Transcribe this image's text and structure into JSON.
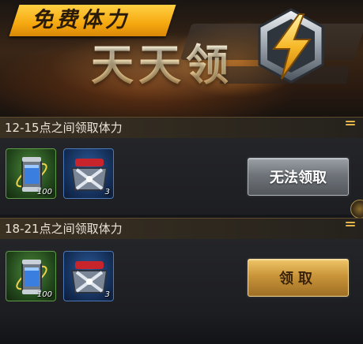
{
  "banner": {
    "tag": "免费体力",
    "title": "天天领",
    "emblem_icon": "lightning-bolt-emblem-icon"
  },
  "slots": [
    {
      "title": "12-15点之间领取体力",
      "items": [
        {
          "icon": "energy-canister-icon",
          "rarity": "green",
          "count": "100"
        },
        {
          "icon": "blue-car-token-icon",
          "rarity": "blue",
          "count": "3"
        }
      ],
      "button": {
        "label": "无法领取",
        "state": "disabled"
      }
    },
    {
      "title": "18-21点之间领取体力",
      "items": [
        {
          "icon": "energy-canister-icon",
          "rarity": "green",
          "count": "100"
        },
        {
          "icon": "blue-car-token-icon",
          "rarity": "blue",
          "count": "3"
        }
      ],
      "button": {
        "label": "领取",
        "state": "active"
      }
    }
  ],
  "colors": {
    "tag_gold": "#f5a80f",
    "button_gold": "#c99439",
    "button_gray": "#6f747a",
    "header_brown": "#3b3123",
    "background": "#151619"
  }
}
